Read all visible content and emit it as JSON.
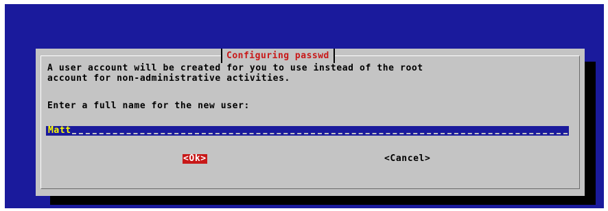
{
  "dialog": {
    "title": "Configuring passwd",
    "message_line1": "A user account will be created for you to use instead of the root",
    "message_line2": "account for non-administrative activities.",
    "prompt": "Enter a full name for the new user:",
    "input_value": "Matt",
    "ok_label": "<Ok>",
    "cancel_label": "<Cancel>"
  },
  "colors": {
    "background": "#1a1a9c",
    "dialog": "#c4c4c4",
    "title": "#c81818",
    "input_text": "#ffff00",
    "focused_button": "#c81818"
  }
}
